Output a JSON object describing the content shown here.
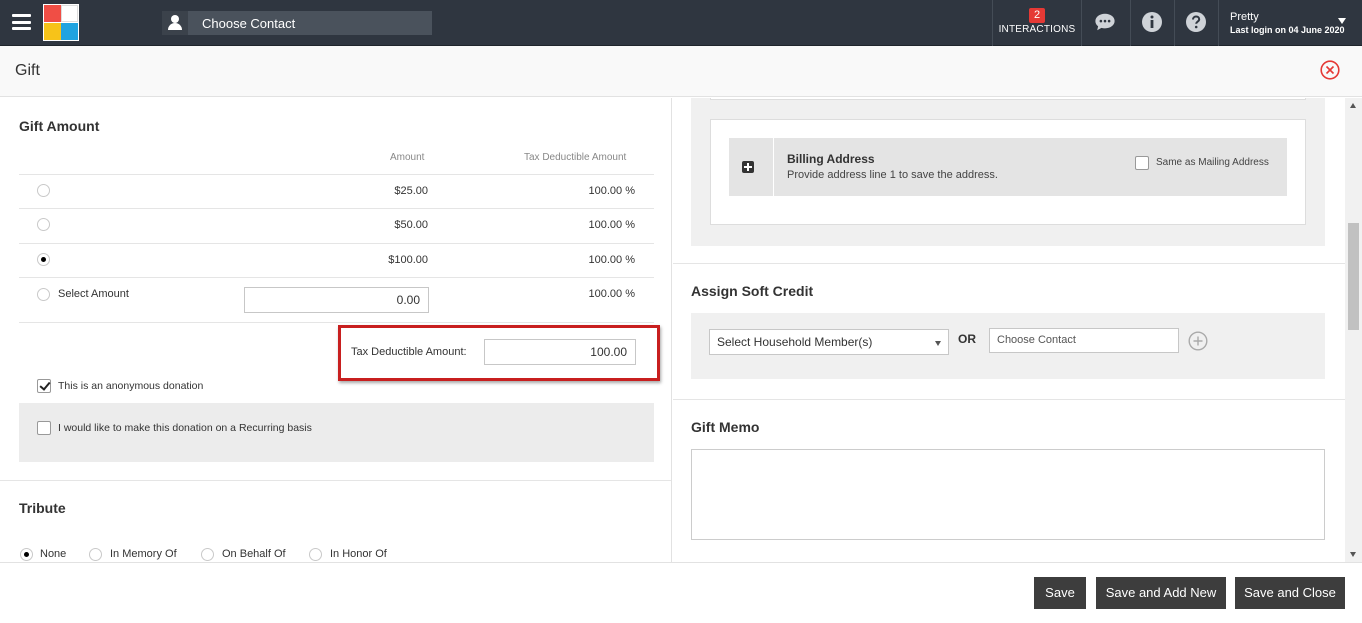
{
  "topbar": {
    "contact_placeholder": "Choose Contact",
    "interactions_count": "2",
    "interactions_label": "INTERACTIONS",
    "user_name": "Pretty",
    "last_login": "Last login on 04 June 2020",
    "icons": [
      "menu-icon",
      "user-icon",
      "chat-icon",
      "info-icon",
      "help-icon",
      "chevron-down-icon"
    ],
    "colors": {
      "bar": "#2f3640",
      "badge": "#e53935"
    }
  },
  "header": {
    "title": "Gift"
  },
  "gift_amount": {
    "title": "Gift Amount",
    "col_amount": "Amount",
    "col_tax": "Tax Deductible Amount",
    "rows": [
      {
        "amount": "$25.00",
        "tax": "100.00 %",
        "selected": false
      },
      {
        "amount": "$50.00",
        "tax": "100.00 %",
        "selected": false
      },
      {
        "amount": "$100.00",
        "tax": "100.00 %",
        "selected": true
      }
    ],
    "select_amount_label": "Select Amount",
    "select_amount_value": "0.00",
    "select_amount_tax": "100.00 %",
    "tax_deductible_label": "Tax Deductible Amount:",
    "tax_deductible_value": "100.00",
    "anonymous_label": "This is an anonymous donation",
    "recurring_label": "I would like to make this donation on a Recurring basis"
  },
  "tribute": {
    "title": "Tribute",
    "options": [
      "None",
      "In Memory Of",
      "On Behalf Of",
      "In Honor Of"
    ],
    "selected": "None"
  },
  "billing": {
    "title": "Billing Address",
    "subtitle": "Provide address line 1 to save the address.",
    "same_as_label": "Same as Mailing Address"
  },
  "soft_credit": {
    "title": "Assign Soft Credit",
    "select_label": "Select Household Member(s)",
    "or_label": "OR",
    "contact_placeholder": "Choose Contact"
  },
  "memo": {
    "title": "Gift Memo"
  },
  "footer": {
    "save": "Save",
    "save_add_new": "Save and Add New",
    "save_close": "Save and Close"
  }
}
